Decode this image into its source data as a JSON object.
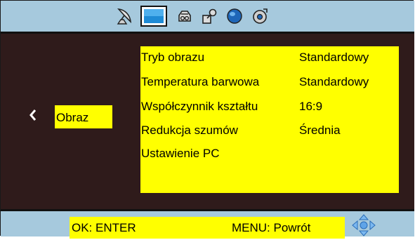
{
  "icon_bar": {
    "icons": [
      "satellite-dish-icon",
      "picture-icon",
      "audio-icon",
      "key-lock-icon",
      "globe-icon",
      "settings-disc-icon"
    ],
    "selected": "picture-icon"
  },
  "menu": {
    "category": "Obraz",
    "items": [
      {
        "label": "Tryb obrazu",
        "value": "Standardowy"
      },
      {
        "label": "Temperatura barwowa",
        "value": "Standardowy"
      },
      {
        "label": "Współczynnik kształtu",
        "value": "16:9"
      },
      {
        "label": "Redukcja szumów",
        "value": "Średnia"
      },
      {
        "label": "Ustawienie PC",
        "value": ""
      }
    ]
  },
  "footer": {
    "ok_hint": "OK: ENTER",
    "menu_hint": "MENU: Powrót"
  },
  "colors": {
    "background": "#2f1b1b",
    "bars": "#a6c9dd",
    "highlight": "#ffff00"
  }
}
